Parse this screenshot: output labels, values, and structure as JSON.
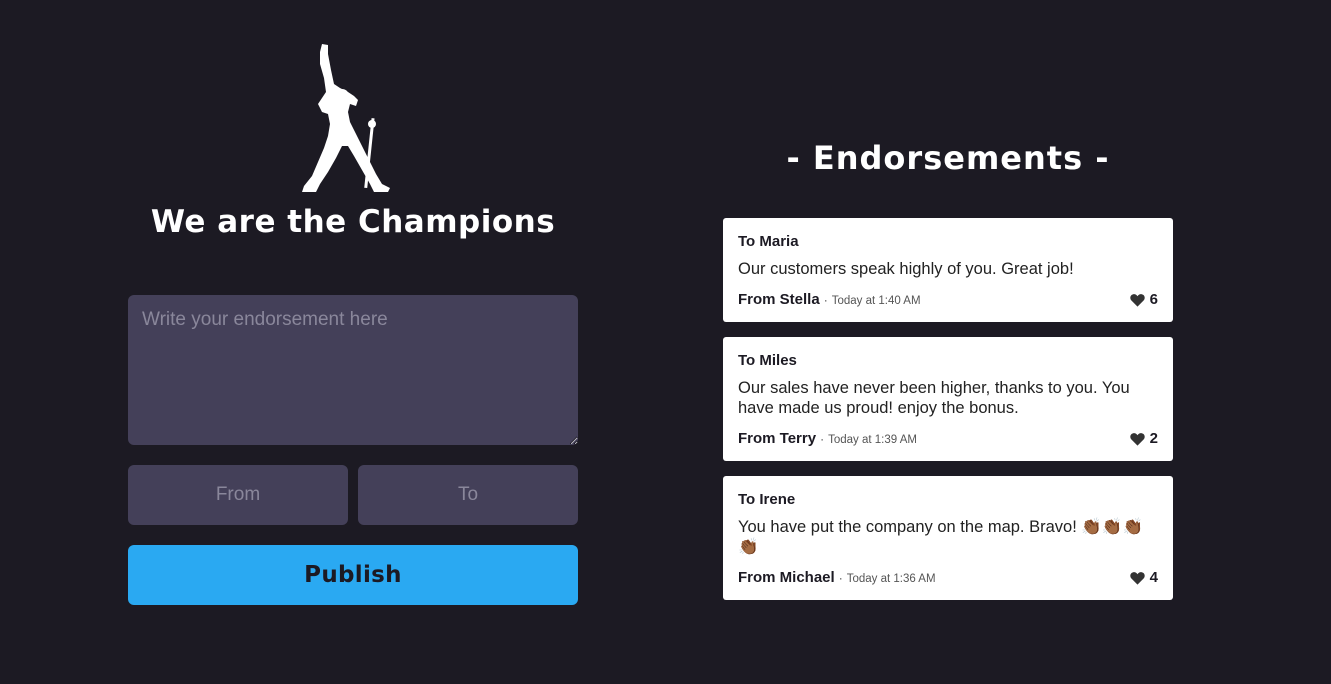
{
  "app": {
    "title": "We are the Champions",
    "logo_icon": "champion-silhouette-icon"
  },
  "form": {
    "endorsement_placeholder": "Write your endorsement here",
    "endorsement_value": "",
    "from_placeholder": "From",
    "from_value": "",
    "to_placeholder": "To",
    "to_value": "",
    "publish_label": "Publish"
  },
  "endorsements": {
    "title": "- Endorsements -",
    "items": [
      {
        "to": "To Maria",
        "message": "Our customers speak highly of you. Great job!",
        "from": "From Stella",
        "separator": "·",
        "time": "Today at 1:40 AM",
        "likes": "6",
        "like_icon": "heart-icon"
      },
      {
        "to": "To Miles",
        "message": "Our sales have never been higher, thanks to you. You have made us proud! enjoy the bonus.",
        "from": "From Terry",
        "separator": "·",
        "time": "Today at 1:39 AM",
        "likes": "2",
        "like_icon": "heart-icon"
      },
      {
        "to": "To Irene",
        "message": "You have put the company on the map. Bravo! 👏🏾👏🏾👏🏾👏🏾",
        "from": "From Michael",
        "separator": "·",
        "time": "Today at 1:36 AM",
        "likes": "4",
        "like_icon": "heart-icon"
      }
    ]
  },
  "colors": {
    "background": "#1c1a23",
    "input_bg": "#444059",
    "accent": "#2aa9f2",
    "card_bg": "#ffffff"
  }
}
